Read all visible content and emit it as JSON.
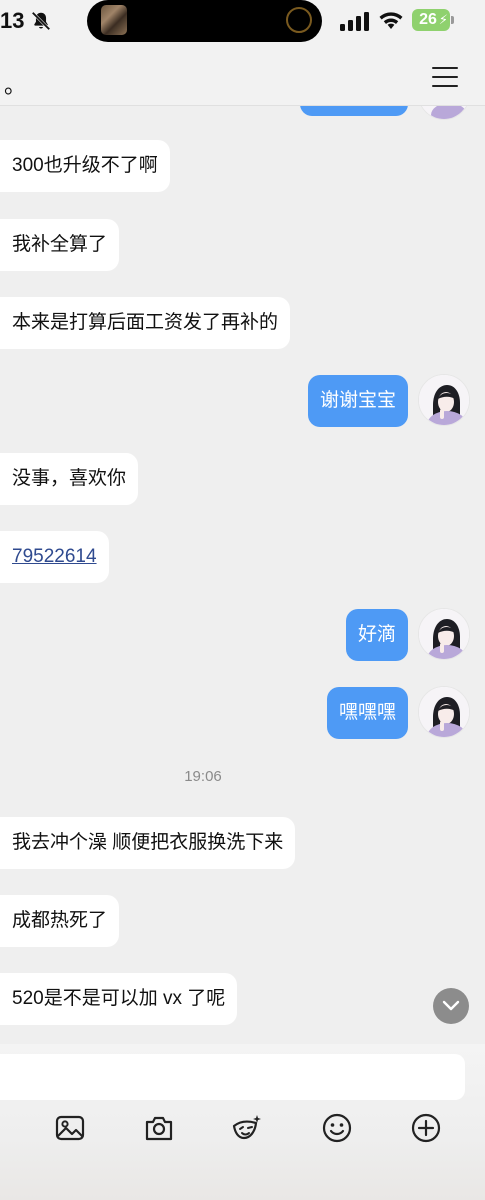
{
  "status_bar": {
    "time": "13",
    "battery": "26"
  },
  "header": {
    "title": "。"
  },
  "messages": [
    {
      "side": "in",
      "text": "300也升级不了啊"
    },
    {
      "side": "in",
      "text": "我补全算了"
    },
    {
      "side": "in",
      "text": "本来是打算后面工资发了再补的"
    },
    {
      "side": "out",
      "text": "谢谢宝宝"
    },
    {
      "side": "in",
      "text": "没事，喜欢你"
    },
    {
      "side": "in",
      "text": "79522614"
    },
    {
      "side": "out",
      "text": "好滴"
    },
    {
      "side": "out",
      "text": "嘿嘿嘿"
    },
    {
      "side": "time",
      "text": "19:06"
    },
    {
      "side": "in",
      "text": "我去冲个澡 顺便把衣服换洗下来"
    },
    {
      "side": "in",
      "text": "成都热死了"
    },
    {
      "side": "in",
      "text": "520是不是可以加 vx 了呢"
    }
  ],
  "input": {
    "value": "",
    "placeholder": ""
  },
  "toolbar": [
    "image-icon",
    "camera-icon",
    "sticker-icon",
    "emoji-icon",
    "plus-icon"
  ],
  "colors": {
    "outgoing_bubble": "#4e9af5",
    "incoming_bubble": "#ffffff",
    "background": "#efefef",
    "battery": "#8fd16e"
  }
}
